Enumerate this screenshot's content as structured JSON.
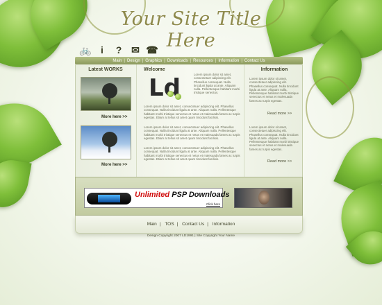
{
  "site": {
    "title": "Your Site Title Here"
  },
  "toolbar_icons": [
    "bicycle-icon",
    "info-icon",
    "help-icon",
    "mail-icon",
    "phone-icon"
  ],
  "nav": [
    "Main",
    "Design",
    "Graphics",
    "Downloads",
    "Resources",
    "Information",
    "Contact Us"
  ],
  "left_column": {
    "heading": "Latest WORKS",
    "more_label": "More here >>"
  },
  "center_column": {
    "heading": "Welcome",
    "logo_text": "Ld",
    "intro": "Lorem ipsum dolor sit amet, consectetuer adipiscing elit. Phasellus consequat. Nulla tincidunt ligula at ante. Aliquam nulla. Pellentesque habitant morbi tristique senectus.",
    "paragraph": "Lorem ipsum dolor sit amet, consectetuer adipiscing elit. Phasellus consequat. Nulla tincidunt ligula at ante. Aliquam nulla. Pellentesque habitant morbi tristique senectus et netus et malesuada fames ac turpis egestas. Etiam at tellus sit amet quam tincidunt facilisis."
  },
  "right_column": {
    "heading": "Information",
    "paragraph": "Lorem ipsum dolor sit amet, consectetuer adipiscing elit. Phasellus consequat. Nulla tincidunt ligula at ante. Aliquam nulla. Pellentesque habitant morbi tristique senectus et netus et malesuada fames ac turpis egestas.",
    "read_more": "Read more >>"
  },
  "banner": {
    "word1": "Unlimited",
    "word2": "PSP Downloads",
    "click": "Click here"
  },
  "footer": {
    "links": [
      "Main",
      "TOS",
      "Contact Us",
      "Information"
    ],
    "copyright": "Design Copyright 2007 LD1991  |  Site Copyright Your Name"
  },
  "colors": {
    "accent": "#8b995c",
    "title": "#8e8a4c",
    "leaf": "#7fbf3a"
  }
}
